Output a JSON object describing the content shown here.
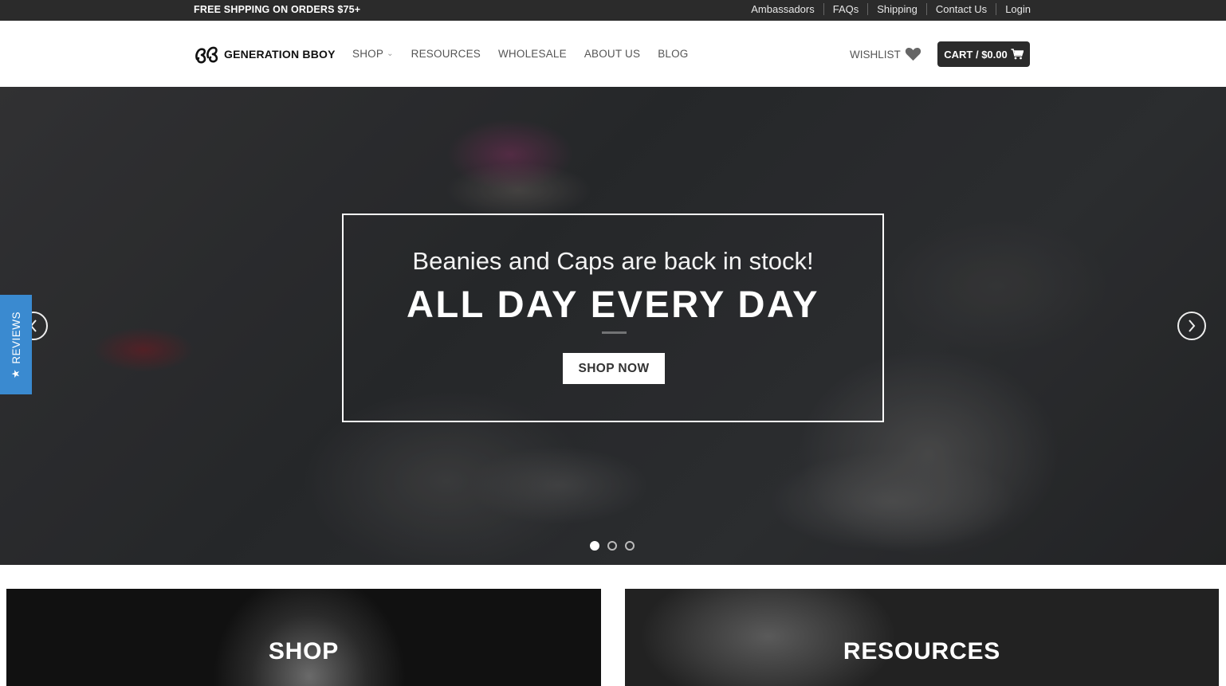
{
  "topbar": {
    "promo": "FREE SHPPING ON ORDERS $75+",
    "links": [
      "Ambassadors",
      "FAQs",
      "Shipping",
      "Contact Us",
      "Login"
    ]
  },
  "header": {
    "logo_text": "GENERATION BBOY",
    "nav": [
      {
        "label": "SHOP",
        "has_dropdown": true
      },
      {
        "label": "RESOURCES"
      },
      {
        "label": "WHOLESALE"
      },
      {
        "label": "ABOUT US"
      },
      {
        "label": "BLOG"
      }
    ],
    "wishlist_label": "WISHLIST",
    "cart_label": "CART / $0.00"
  },
  "hero": {
    "subtitle": "Beanies and Caps are back in stock!",
    "title": "ALL DAY EVERY DAY",
    "button": "SHOP NOW",
    "slide_count": 3,
    "active_slide": 1
  },
  "reviews_tab": {
    "label": "REVIEWS",
    "icon": "star-icon"
  },
  "tiles": [
    {
      "label": "SHOP"
    },
    {
      "label": "RESOURCES"
    }
  ],
  "colors": {
    "topbar": "#2b2b2b",
    "reviews_tab": "#3a8ad0",
    "cart": "#2b2b2b"
  }
}
